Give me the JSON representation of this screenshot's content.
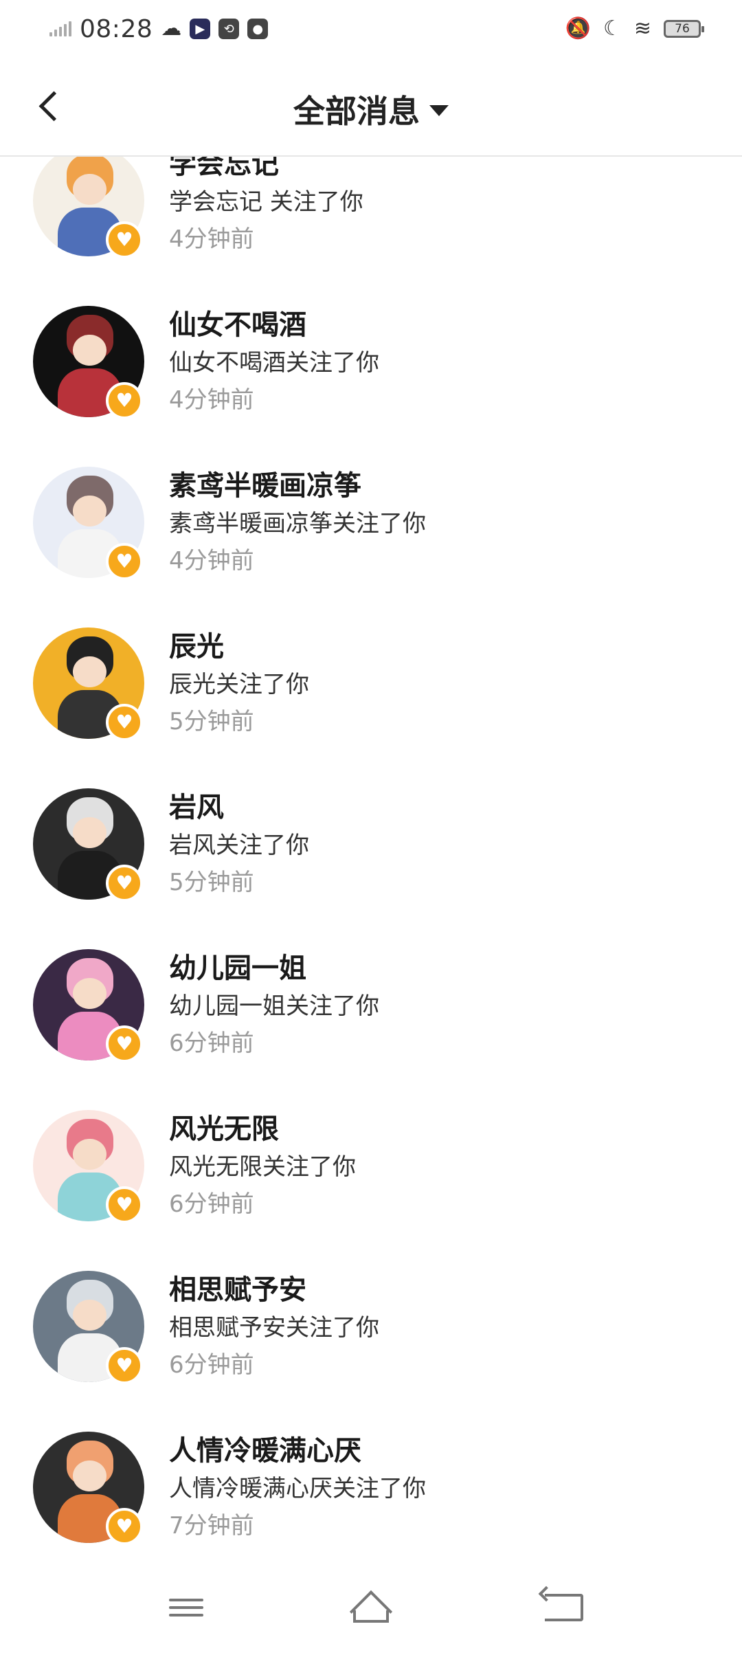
{
  "status_bar": {
    "time": "08:28",
    "battery": "76",
    "icons": [
      "signal-icon",
      "cloud-icon",
      "video-app-icon",
      "sync-app-icon",
      "play-app-icon",
      "mute-bell-icon",
      "moon-icon",
      "wifi-icon",
      "battery-icon"
    ]
  },
  "header": {
    "back_icon": "chevron-left-icon",
    "title": "全部消息",
    "dropdown_icon": "caret-down-icon"
  },
  "notifications": [
    {
      "name": "学会忘记",
      "action": "学会忘记 关注了你",
      "time": "4分钟前",
      "colors": {
        "bg": "#f4efe6",
        "hair": "#f0a24a",
        "body": "#4f6fb8"
      }
    },
    {
      "name": "仙女不喝酒",
      "action": "仙女不喝酒关注了你",
      "time": "4分钟前",
      "colors": {
        "bg": "#111111",
        "hair": "#8a2b2b",
        "body": "#b8323a"
      }
    },
    {
      "name": "素鸢半暖画凉筝",
      "action": "素鸢半暖画凉筝关注了你",
      "time": "4分钟前",
      "colors": {
        "bg": "#e9edf6",
        "hair": "#7e6a6a",
        "body": "#f4f4f4"
      }
    },
    {
      "name": "辰光",
      "action": "辰光关注了你",
      "time": "5分钟前",
      "colors": {
        "bg": "#f1b028",
        "hair": "#222222",
        "body": "#333333"
      }
    },
    {
      "name": "岩风",
      "action": "岩风关注了你",
      "time": "5分钟前",
      "colors": {
        "bg": "#2c2c2c",
        "hair": "#e0e0e0",
        "body": "#1d1d1d"
      }
    },
    {
      "name": "幼儿园一姐",
      "action": "幼儿园一姐关注了你",
      "time": "6分钟前",
      "colors": {
        "bg": "#3a2945",
        "hair": "#f0a8c8",
        "body": "#ec8cc0"
      }
    },
    {
      "name": "风光无限",
      "action": "风光无限关注了你",
      "time": "6分钟前",
      "colors": {
        "bg": "#fbe7e2",
        "hair": "#e87a8a",
        "body": "#8ed3d8"
      }
    },
    {
      "name": "相思赋予安",
      "action": "相思赋予安关注了你",
      "time": "6分钟前",
      "colors": {
        "bg": "#6c7a88",
        "hair": "#d8dde2",
        "body": "#f2f2f2"
      }
    },
    {
      "name": "人情冷暖满心厌",
      "action": "人情冷暖满心厌关注了你",
      "time": "7分钟前",
      "colors": {
        "bg": "#2e2e2e",
        "hair": "#f0a070",
        "body": "#e07a3c"
      }
    }
  ],
  "badge": {
    "icon": "heart-icon",
    "color": "#f7a81b"
  },
  "nav_bar": {
    "icons": [
      "menu-icon",
      "home-icon",
      "back-icon"
    ]
  }
}
